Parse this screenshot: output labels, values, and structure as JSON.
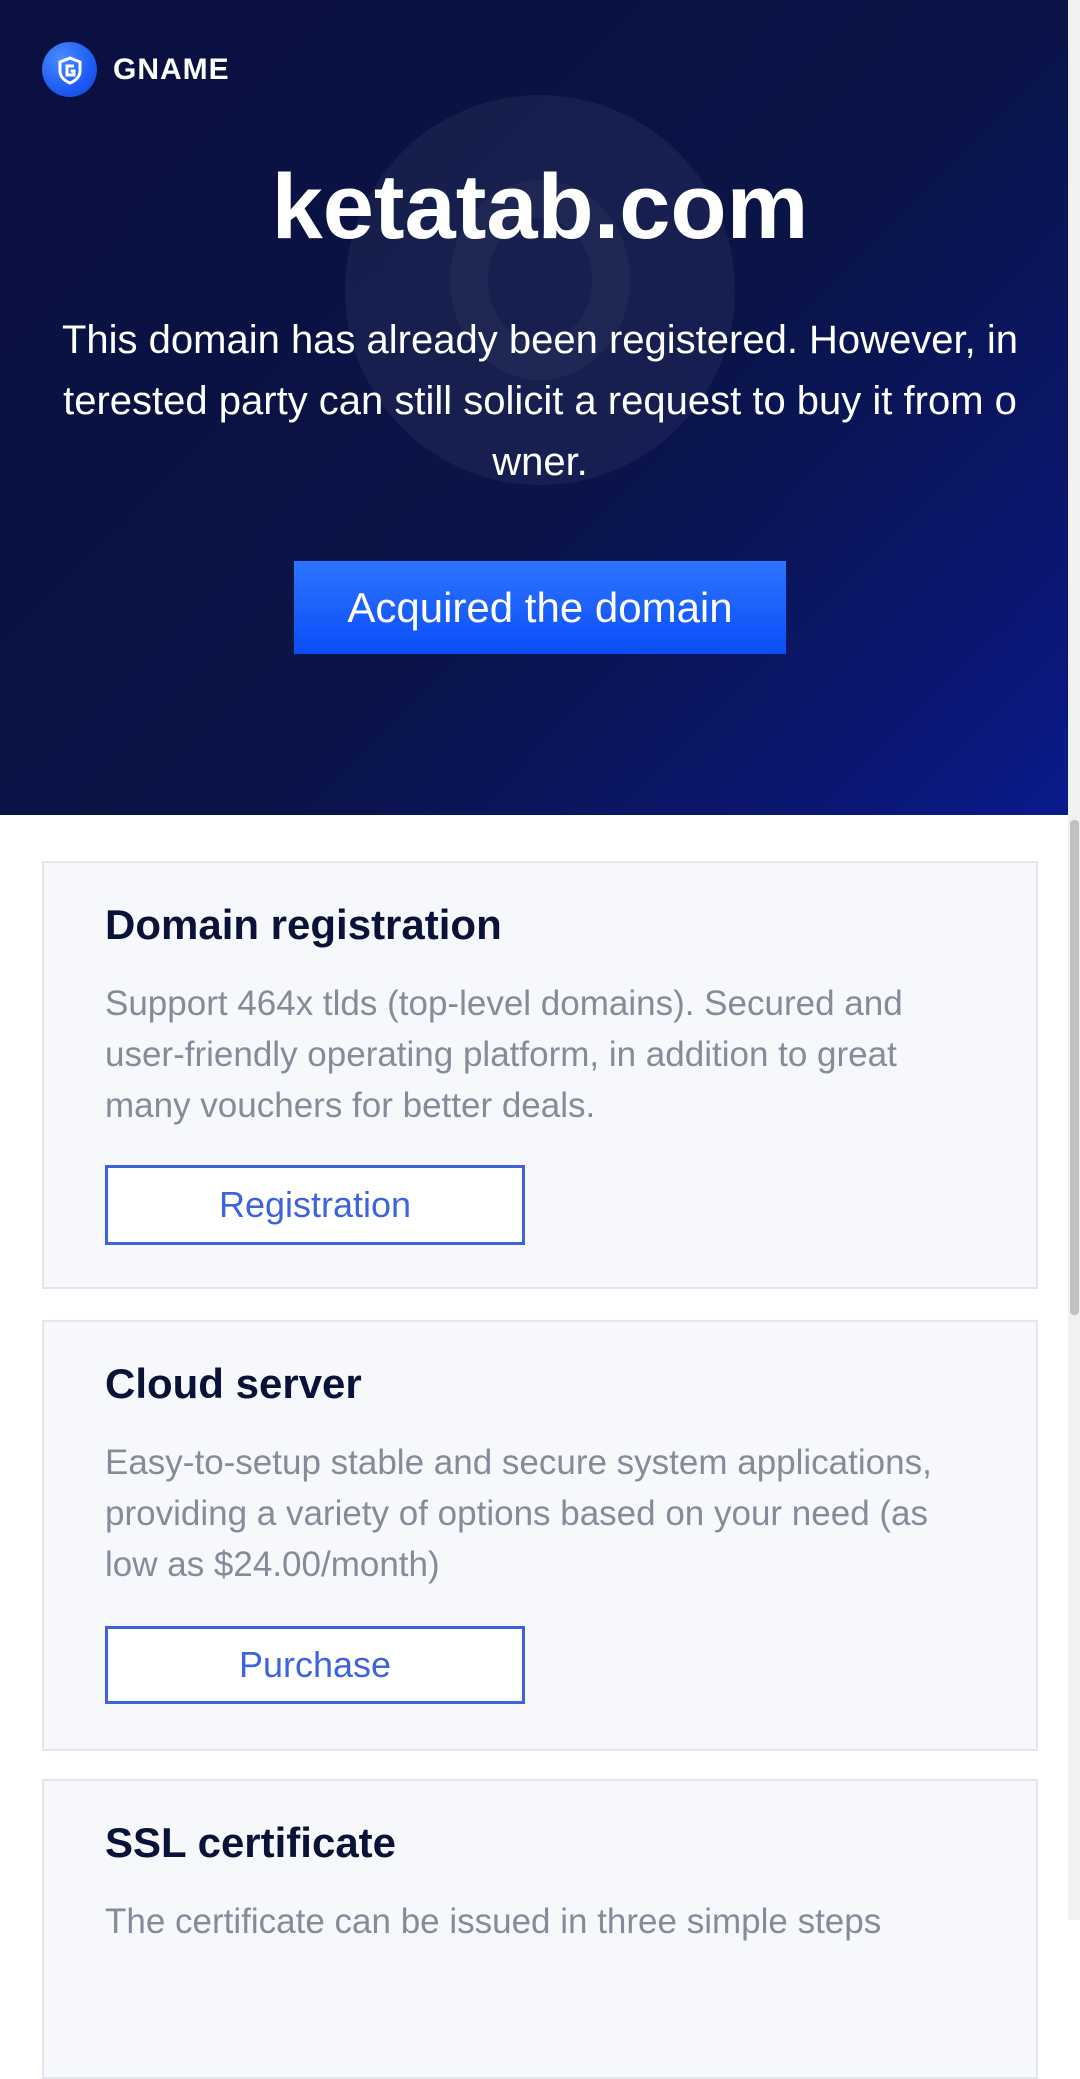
{
  "brand": {
    "name": "GNAME",
    "logo_icon": "gname-g-logo-icon"
  },
  "hero": {
    "domain": "ketatab.com",
    "message": "This domain has already been registered. However, interested party can still solicit a request to buy it from owner.",
    "cta_label": "Acquired the domain"
  },
  "colors": {
    "hero_bg": "#0a1446",
    "accent": "#0a4ef7",
    "card_bg": "#f7f8fc",
    "card_button": "#3d63dd"
  },
  "cards": [
    {
      "title": "Domain registration",
      "description": "Support 464x tlds (top-level domains). Secured and user-friendly operating platform, in addition to great many vouchers for better deals.",
      "button": "Registration"
    },
    {
      "title": "Cloud server",
      "description": "Easy-to-setup stable and secure system applications, providing a variety of options based on your need (as low as $24.00/month)",
      "button": "Purchase"
    },
    {
      "title": "SSL certificate",
      "description": "The certificate can be issued in three simple steps"
    }
  ]
}
